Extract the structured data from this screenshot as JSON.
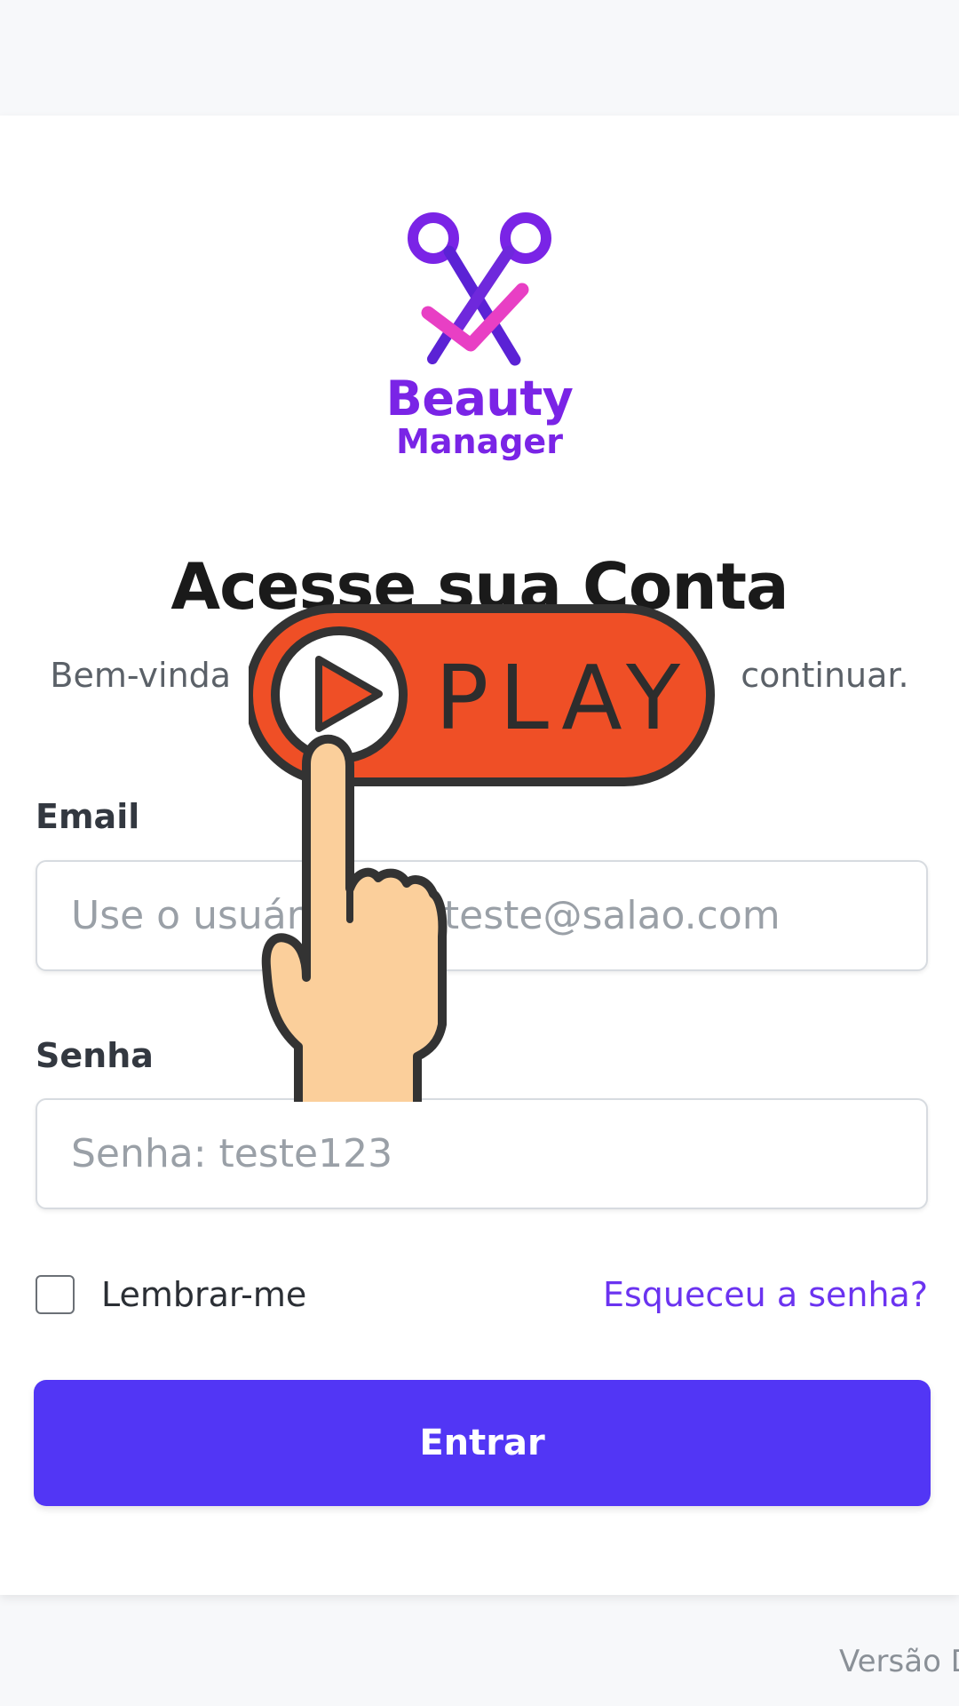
{
  "logo": {
    "line1": "Beauty",
    "line2": "Manager",
    "icon": "scissors-check-icon",
    "colors": {
      "primary": "#7a24e6",
      "accent": "#e83fc4"
    }
  },
  "header": {
    "title": "Acesse sua Conta",
    "subtitle_left": "Bem-vinda",
    "subtitle_right": "continuar."
  },
  "form": {
    "email_label": "Email",
    "email_placeholder": "Use o usuário user.teste@salao.com",
    "password_label": "Senha",
    "password_placeholder": "Senha: teste123",
    "remember_label": "Lembrar-me",
    "forgot_label": "Esqueceu a senha?",
    "submit_label": "Entrar"
  },
  "footer": {
    "version": "Versão D"
  },
  "overlay": {
    "play_label": "PLAY",
    "icon": "play-button-hand-icon",
    "colors": {
      "pill": "#ef4f26",
      "hand": "#fbcf9b",
      "outline": "#333333"
    }
  }
}
